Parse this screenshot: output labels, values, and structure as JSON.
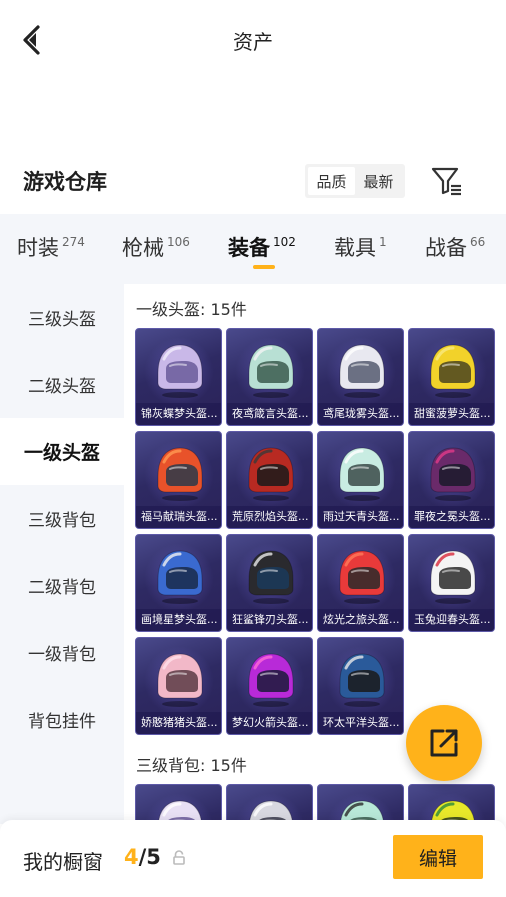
{
  "header": {
    "title": "资产",
    "back_icon": "chevron-left-icon"
  },
  "section": {
    "title": "游戏仓库"
  },
  "sort": {
    "options": [
      "品质",
      "最新"
    ],
    "active": 0
  },
  "filter": {
    "icon": "filter-icon"
  },
  "tabs": [
    {
      "label": "时装",
      "count": "274"
    },
    {
      "label": "枪械",
      "count": "106"
    },
    {
      "label": "装备",
      "count": "102"
    },
    {
      "label": "载具",
      "count": "1"
    },
    {
      "label": "战备",
      "count": "66"
    }
  ],
  "active_tab": 2,
  "categories": [
    "三级头盔",
    "二级头盔",
    "一级头盔",
    "三级背包",
    "二级背包",
    "一级背包",
    "背包挂件"
  ],
  "active_category": 2,
  "groups": [
    {
      "title": "一级头盔: 15件",
      "items": [
        {
          "name": "锦灰蝶梦头盔...",
          "color": "#c9b8e8",
          "accent": "#f2eefb",
          "visor": "#6a5a9a"
        },
        {
          "name": "夜鸢箴言头盔...",
          "color": "#b8e0d4",
          "accent": "#f4f4f4",
          "visor": "#3a5a4e"
        },
        {
          "name": "鸢尾珑雾头盔...",
          "color": "#e8e8f0",
          "accent": "#ffffff",
          "visor": "#555a70"
        },
        {
          "name": "甜蜜菠萝头盔...",
          "color": "#f2d22a",
          "accent": "#f8e880",
          "visor": "#4a4420"
        },
        {
          "name": "福马献瑞头盔...",
          "color": "#e8522a",
          "accent": "#ff9a52",
          "visor": "#2a3a4a"
        },
        {
          "name": "荒原烈焰头盔...",
          "color": "#b82a22",
          "accent": "#3a3a3a",
          "visor": "#1a1a1a"
        },
        {
          "name": "雨过天青头盔...",
          "color": "#c8ece2",
          "accent": "#ffffff",
          "visor": "#3a4a48"
        },
        {
          "name": "罪夜之冕头盔...",
          "color": "#6a2a6a",
          "accent": "#e23a8a",
          "visor": "#1a1a2a"
        },
        {
          "name": "画境星梦头盔...",
          "color": "#3a6ad0",
          "accent": "#f0f0f0",
          "visor": "#1a2a4a"
        },
        {
          "name": "狂鲨锋刃头盔...",
          "color": "#2a2a2e",
          "accent": "#e8e8e8",
          "visor": "#1a3a5a"
        },
        {
          "name": "炫光之旅头盔...",
          "color": "#e83a3a",
          "accent": "#ff7a5a",
          "visor": "#2a2a2a"
        },
        {
          "name": "玉兔迎春头盔...",
          "color": "#f4f4f4",
          "accent": "#d8283a",
          "visor": "#2a2a2a"
        },
        {
          "name": "娇憨猪猪头盔...",
          "color": "#f2b8c8",
          "accent": "#ffe0ea",
          "visor": "#5a3a44"
        },
        {
          "name": "梦幻火箭头盔...",
          "color": "#b82ad8",
          "accent": "#ff6ad8",
          "visor": "#1a1a3a"
        },
        {
          "name": "环太平洋头盔...",
          "color": "#2a5a9a",
          "accent": "#e8e8e8",
          "visor": "#1a1a1a"
        }
      ]
    },
    {
      "title": "三级背包: 15件",
      "items": [
        {
          "name": "",
          "color": "#e8e0f4",
          "accent": "#ffffff",
          "visor": "#6a5a9a"
        },
        {
          "name": "",
          "color": "#d8d8e0",
          "accent": "#ffffff",
          "visor": "#3a3a4a"
        },
        {
          "name": "",
          "color": "#b8e8d8",
          "accent": "#2a2a2a",
          "visor": "#3a5a4e"
        },
        {
          "name": "",
          "color": "#e8e82a",
          "accent": "#2a8a3a",
          "visor": "#2a3a1a"
        }
      ]
    }
  ],
  "showcase": {
    "label": "我的橱窗",
    "current": "4",
    "total": "/5",
    "lock_icon": "lock-icon"
  },
  "edit_button": "编辑",
  "share_icon": "share-icon"
}
